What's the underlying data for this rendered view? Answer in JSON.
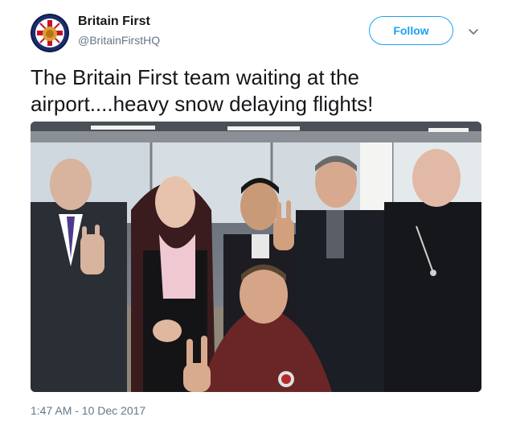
{
  "tweet": {
    "author_name": "Britain First",
    "author_handle": "@BritainFirstHQ",
    "follow_label": "Follow",
    "text": "The Britain First team waiting at the airport....heavy snow delaying flights!",
    "timestamp": "1:47 AM - 10 Dec 2017"
  },
  "icons": {
    "avatar": "britain-first-logo",
    "menu": "chevron-down-icon"
  },
  "colors": {
    "accent": "#1da1f2",
    "secondary_text": "#657786",
    "primary_text": "#14171a"
  }
}
